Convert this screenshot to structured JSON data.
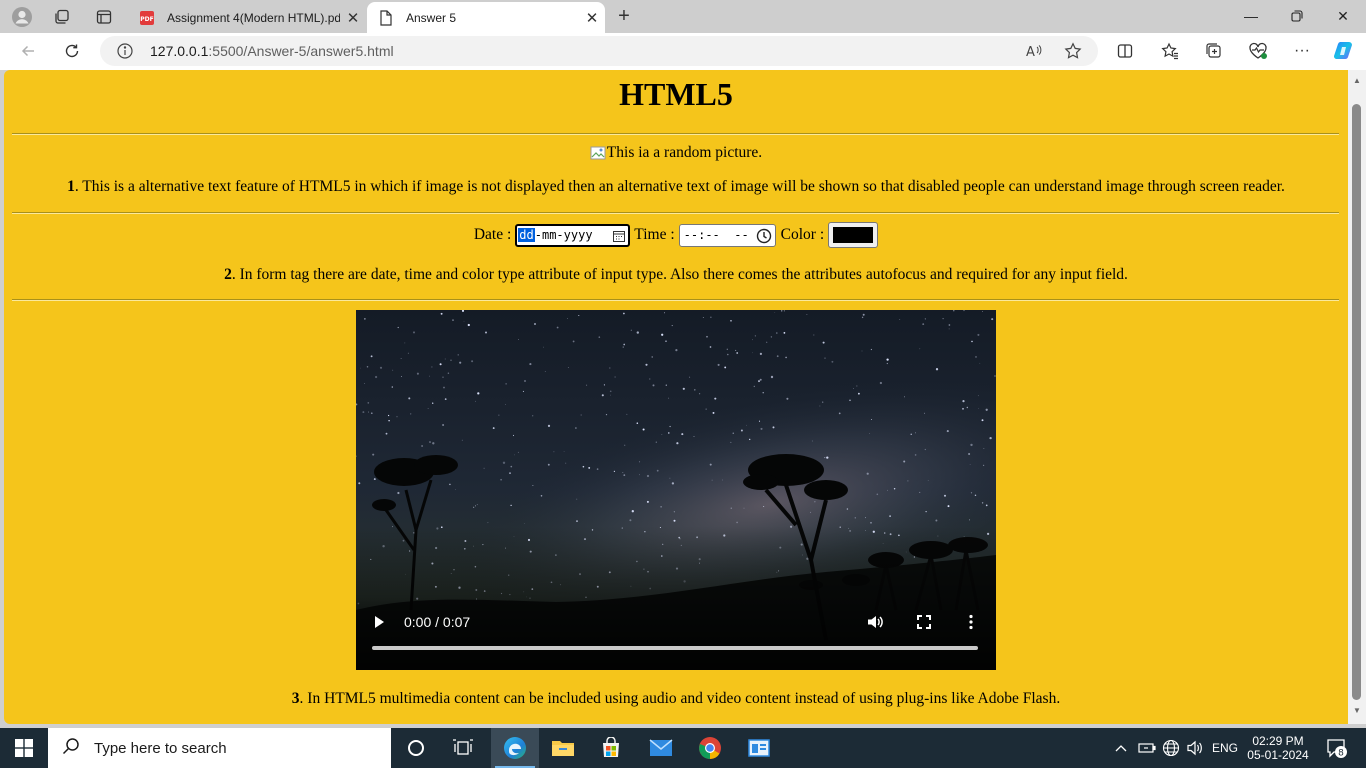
{
  "browser": {
    "tabs": [
      {
        "title": "Assignment 4(Modern HTML).pd",
        "icon": "pdf-icon",
        "active": false
      },
      {
        "title": "Answer 5",
        "icon": "document-icon",
        "active": true
      }
    ],
    "url_host": "127.0.0.1",
    "url_path": ":5500/Answer-5/answer5.html"
  },
  "page": {
    "heading": "HTML5",
    "img_alt": "This ia a random picture.",
    "p1_num": "1",
    "p1_text": ". This is a alternative text feature of HTML5 in which if image is not displayed then an alternative text of image will be shown so that disabled people can understand image through screen reader.",
    "date_label": "Date :",
    "date_sel": "dd",
    "date_rest": "-mm-yyyy",
    "time_label": "Time :",
    "time_value": "--:--  --",
    "color_label": "Color :",
    "color_value": "#000000",
    "p2_num": "2",
    "p2_text": ". In form tag there are date, time and color type attribute of input type. Also there comes the attributes autofocus and required for any input field.",
    "video_time": "0:00 / 0:07",
    "video_progress": 0,
    "p3_num": "3",
    "p3_text": ". In HTML5 multimedia content can be included using audio and video content instead of using plug-ins like Adobe Flash."
  },
  "taskbar": {
    "search_placeholder": "Type here to search",
    "lang": "ENG",
    "time": "02:29 PM",
    "date": "05-01-2024",
    "notif_count": "8"
  },
  "colors": {
    "page_bg": "#f5c51b",
    "taskbar_bg": "#1c2b36",
    "selection": "#0060df"
  }
}
